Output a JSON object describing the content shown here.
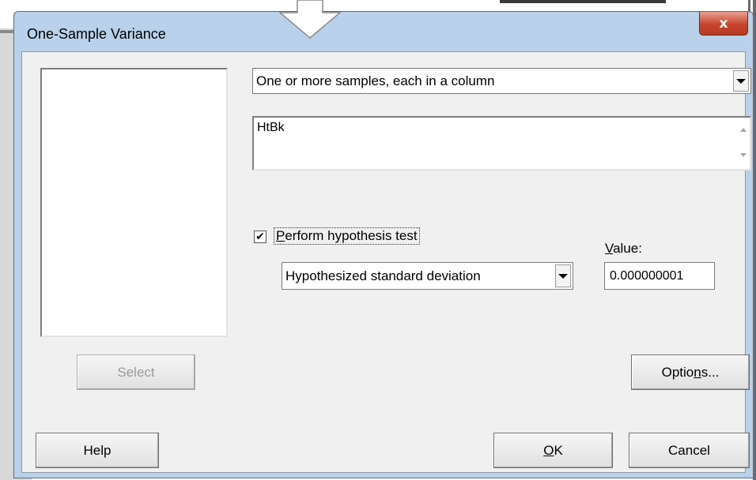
{
  "window": {
    "title": "One-Sample Variance",
    "close_label": "x"
  },
  "variables_list": {
    "items": []
  },
  "data_format": {
    "selected": "One or more samples, each in a column"
  },
  "columns_box": {
    "value": "HtBk"
  },
  "hypothesis": {
    "checked": true,
    "check_mark": "✔",
    "label_mnemonic": "P",
    "label_rest": "erform hypothesis test",
    "selected_option": "Hypothesized standard deviation",
    "value_label_mnemonic": "V",
    "value_label_rest": "alue:",
    "value": "0.000000001"
  },
  "buttons": {
    "select": "Select",
    "options_pre": "Optio",
    "options_mnemonic": "n",
    "options_post": "s...",
    "help": "Help",
    "ok_mnemonic": "O",
    "ok_rest": "K",
    "cancel": "Cancel"
  },
  "colors": {
    "frame": "#b9d1ea",
    "client": "#f0f0f0",
    "close_button": "#c8452c"
  }
}
